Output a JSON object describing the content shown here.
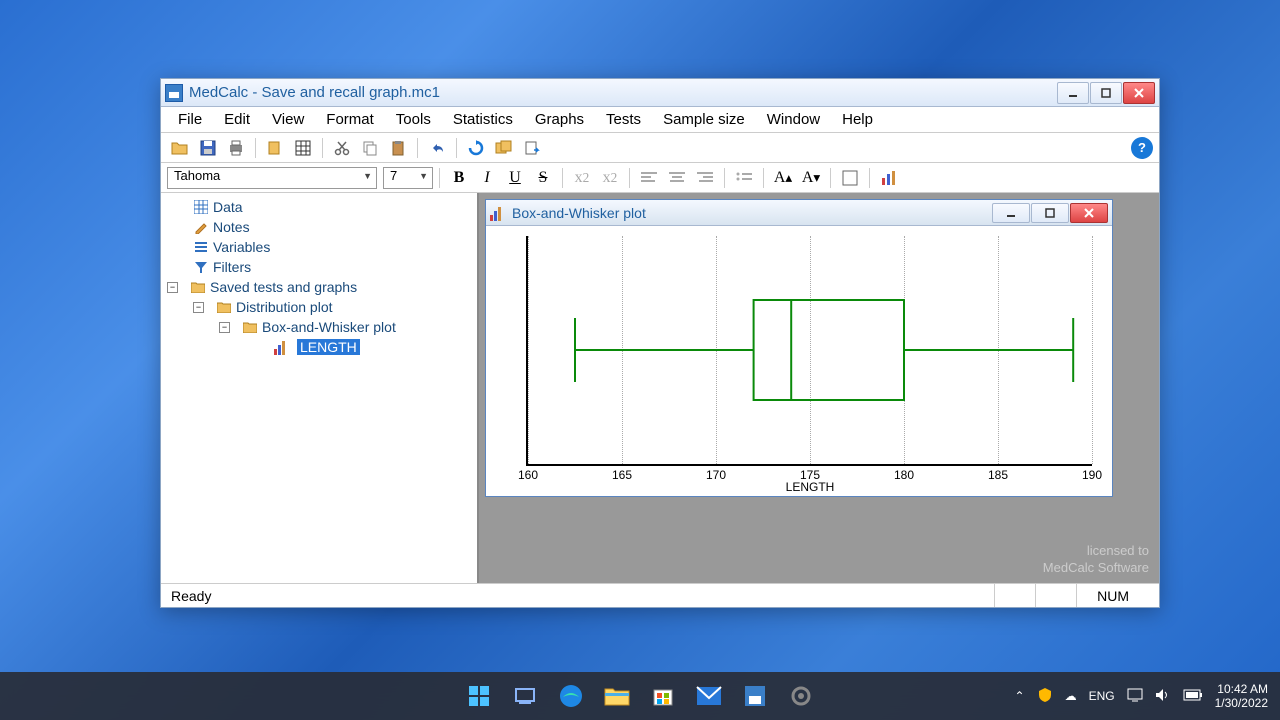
{
  "window": {
    "title": "MedCalc - Save and recall graph.mc1"
  },
  "menu": [
    "File",
    "Edit",
    "View",
    "Format",
    "Tools",
    "Statistics",
    "Graphs",
    "Tests",
    "Sample size",
    "Window",
    "Help"
  ],
  "format": {
    "font": "Tahoma",
    "size": "7"
  },
  "tree": {
    "data": "Data",
    "notes": "Notes",
    "variables": "Variables",
    "filters": "Filters",
    "saved": "Saved tests and graphs",
    "dist": "Distribution plot",
    "box": "Box-and-Whisker plot",
    "length": "LENGTH"
  },
  "childwin": {
    "title": "Box-and-Whisker plot"
  },
  "chart_data": {
    "type": "boxplot",
    "xlabel": "LENGTH",
    "xlim": [
      160,
      190
    ],
    "ticks": [
      160,
      165,
      170,
      175,
      180,
      185,
      190
    ],
    "min": 162.5,
    "q1": 172,
    "median": 174,
    "q3": 180,
    "max": 189
  },
  "license": {
    "line1": "licensed to",
    "line2": "MedCalc Software"
  },
  "status": {
    "ready": "Ready",
    "num": "NUM"
  },
  "tray": {
    "lang": "ENG",
    "time": "10:42 AM",
    "date": "1/30/2022"
  }
}
